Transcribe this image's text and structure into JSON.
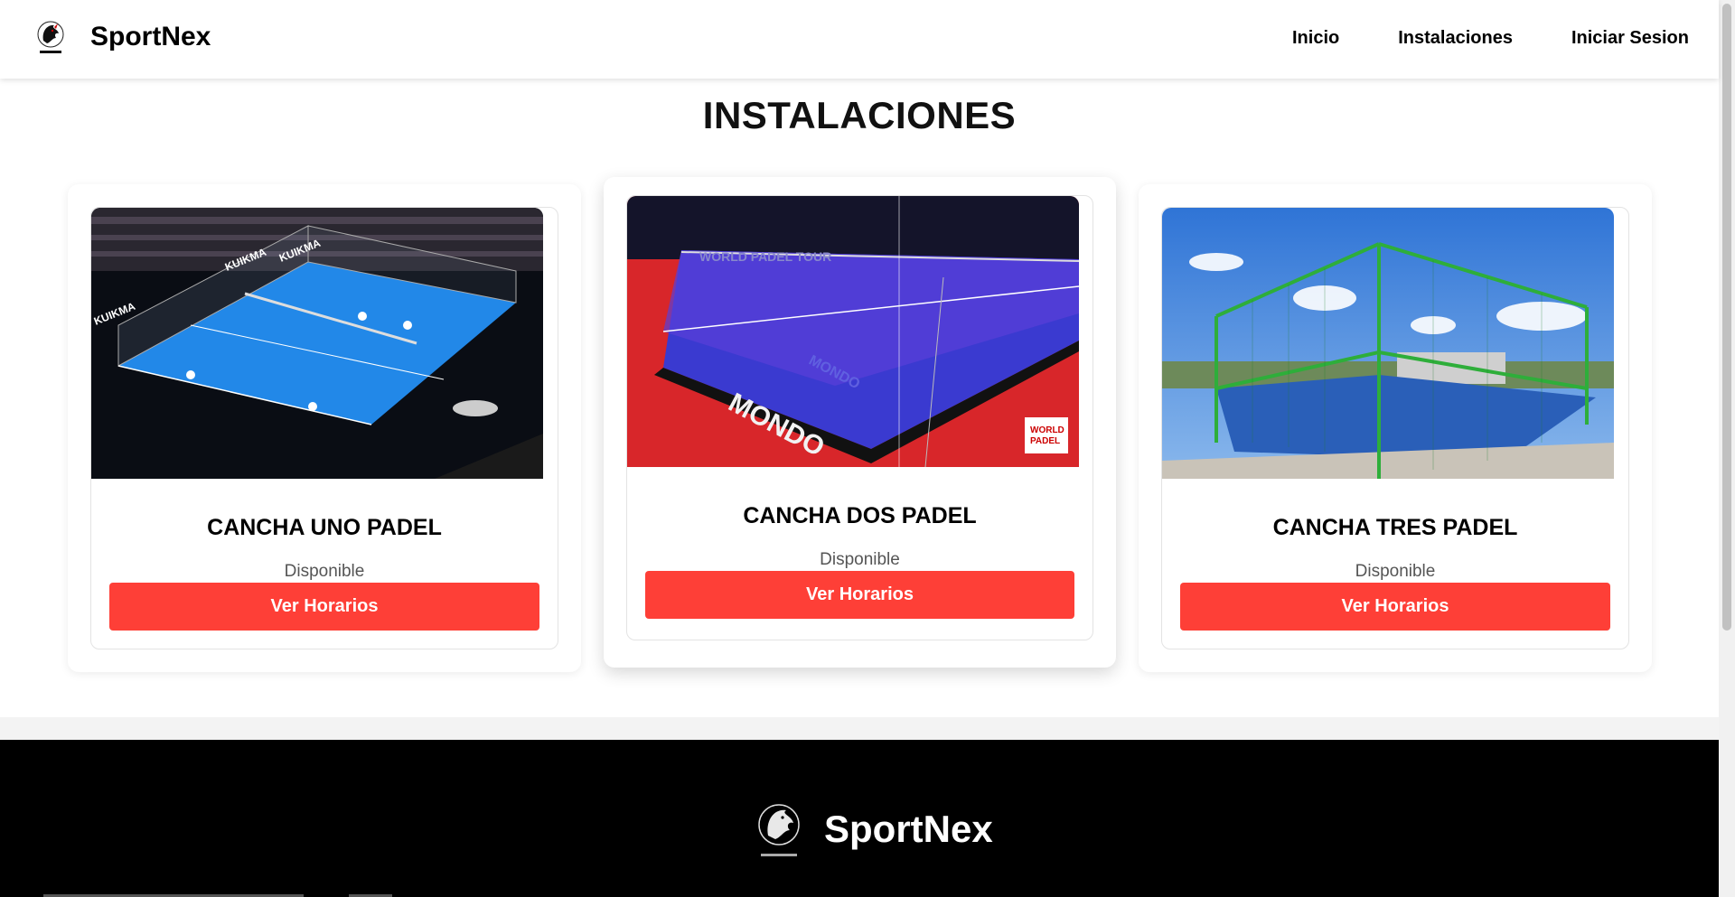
{
  "header": {
    "brand": "SportNex",
    "nav": [
      "Inicio",
      "Instalaciones",
      "Iniciar Sesion"
    ]
  },
  "main": {
    "title": "INSTALACIONES",
    "cards": [
      {
        "title": "CANCHA UNO PADEL",
        "status": "Disponible",
        "button": "Ver Horarios",
        "image": "padel-court-indoor-arena-photo"
      },
      {
        "title": "CANCHA DOS PADEL",
        "status": "Disponible",
        "button": "Ver Horarios",
        "image": "padel-court-world-padel-tour-photo"
      },
      {
        "title": "CANCHA TRES PADEL",
        "status": "Disponible",
        "button": "Ver Horarios",
        "image": "padel-court-outdoor-photo"
      }
    ]
  },
  "footer": {
    "brand": "SportNex"
  },
  "colors": {
    "accent": "#fe3f37",
    "footer_bg": "#000000"
  }
}
